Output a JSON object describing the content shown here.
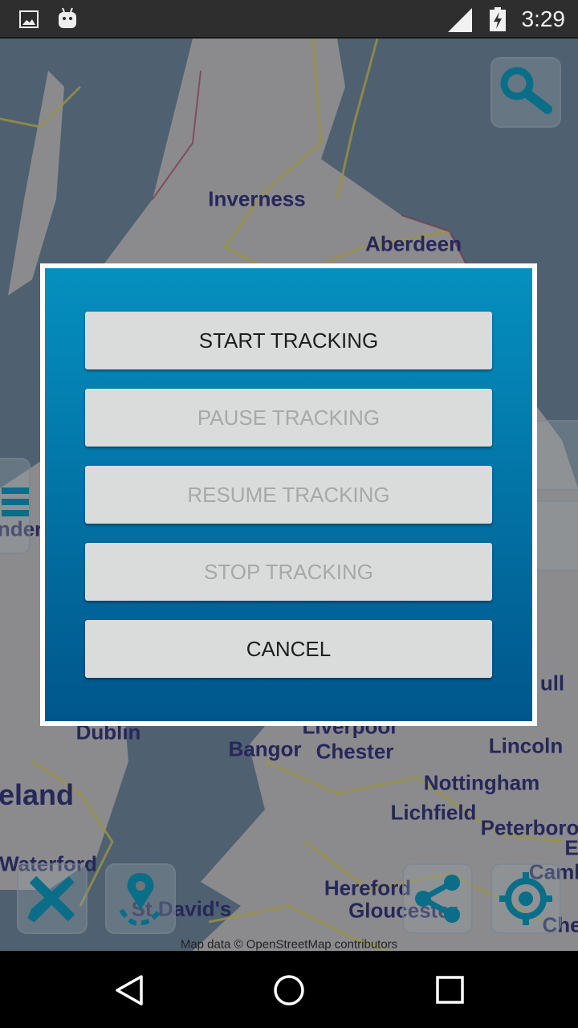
{
  "status_bar": {
    "time": "3:29",
    "icons": [
      "image-icon",
      "android-icon",
      "signal-icon",
      "battery-charging-icon"
    ]
  },
  "map": {
    "cities": [
      {
        "name": "Inverness"
      },
      {
        "name": "Aberdeen"
      },
      {
        "name": "Dublin"
      },
      {
        "name": "Liverpool"
      },
      {
        "name": "Bangor"
      },
      {
        "name": "Chester"
      },
      {
        "name": "Lincoln"
      },
      {
        "name": "Nottingham"
      },
      {
        "name": "Lichfield"
      },
      {
        "name": "Peterboro"
      },
      {
        "name": "eland"
      },
      {
        "name": "Waterford"
      },
      {
        "name": "Hereford"
      },
      {
        "name": "Gloucester"
      },
      {
        "name": "St David's"
      },
      {
        "name": "ull"
      },
      {
        "name": "Camb"
      },
      {
        "name": "Che"
      },
      {
        "name": "E"
      },
      {
        "name": "nder"
      }
    ],
    "attribution": "Map data © OpenStreetMap contributors",
    "buttons": [
      "search-button",
      "measure-button",
      "location-track-button",
      "share-button",
      "my-location-button",
      "layers-button"
    ]
  },
  "dialog": {
    "buttons": [
      {
        "label": "START TRACKING",
        "enabled": true
      },
      {
        "label": "PAUSE TRACKING",
        "enabled": false
      },
      {
        "label": "RESUME TRACKING",
        "enabled": false
      },
      {
        "label": "STOP TRACKING",
        "enabled": false
      },
      {
        "label": "CANCEL",
        "enabled": true
      }
    ]
  },
  "colors": {
    "accent": "#0a6e88",
    "dialog_top": "#0590bf",
    "dialog_bottom": "#00568c"
  }
}
